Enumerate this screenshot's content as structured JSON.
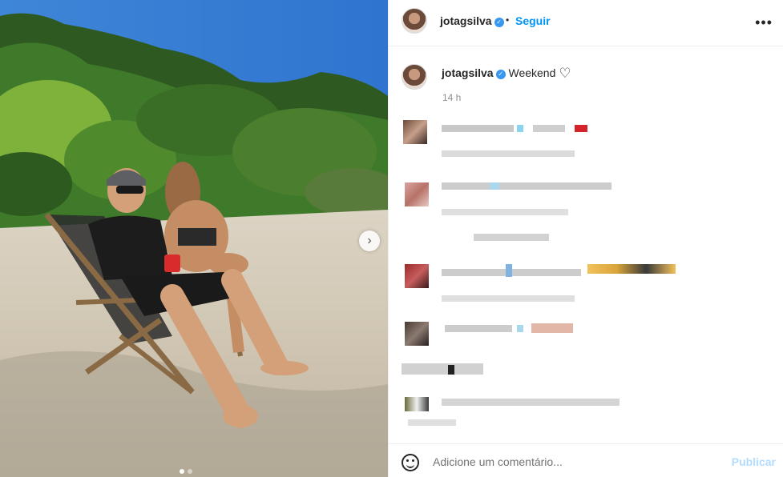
{
  "post": {
    "author": {
      "username": "jotagsilva",
      "verified_icon": "verified-badge-icon",
      "follow_label": "Seguir",
      "separator": "•"
    },
    "more_icon": "more-options-icon",
    "caption": {
      "username": "jotagsilva",
      "text": "Weekend",
      "emoji_icon": "heart-outline-icon",
      "time": "14 h"
    },
    "carousel": {
      "next_icon": "chevron-right-icon",
      "slides": 2,
      "current": 1
    },
    "comment_box": {
      "placeholder": "Adicione um comentário...",
      "publish_label": "Publicar"
    }
  },
  "colors": {
    "accent": "#0095f6",
    "verified": "#3897f0",
    "publish_disabled": "#b3dbff",
    "muted_text": "#8e8e8e"
  }
}
